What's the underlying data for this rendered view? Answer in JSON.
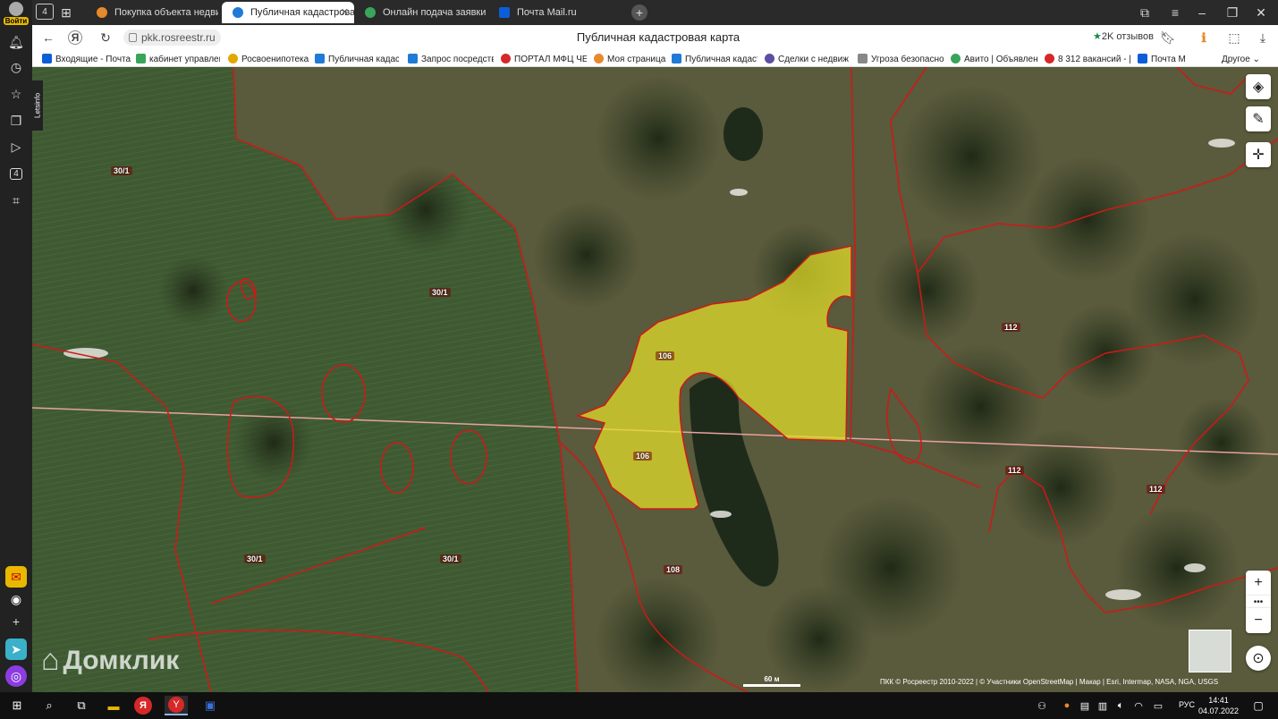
{
  "browser": {
    "login_label": "Войти",
    "tab_count": "4",
    "tabs": [
      {
        "title": "Покупка объекта недвиж",
        "icon": "yandex-realty-icon",
        "color": "#e8892b"
      },
      {
        "title": "Публичная кадастрова",
        "icon": "rosreestr-icon",
        "color": "#1e7bd6",
        "close": "✕"
      },
      {
        "title": "Онлайн подача заявки н",
        "icon": "gosuslugi-icon",
        "color": "#3aa55a"
      },
      {
        "title": "Почта Mail.ru",
        "icon": "mail-icon",
        "color": "#0b5ed7"
      }
    ],
    "url": "pkk.rosreestr.ru",
    "page_title": "Публичная кадастровая карта",
    "reviews": "2K отзывов",
    "bookmarks": [
      {
        "label": "Входящие - Почта",
        "color": "#0b5ed7"
      },
      {
        "label": "кабинет управлен",
        "color": "#3aa55a"
      },
      {
        "label": "Росвоенипотека",
        "color": "#e0a800"
      },
      {
        "label": "Публичная кадаст",
        "color": "#1e7bd6"
      },
      {
        "label": "Запрос посредств",
        "color": "#1e7bd6"
      },
      {
        "label": "ПОРТАЛ МФЦ ЧЕ",
        "color": "#d62828"
      },
      {
        "label": "Моя страница",
        "color": "#e8892b"
      },
      {
        "label": "Публичная кадаст",
        "color": "#1e7bd6"
      },
      {
        "label": "Сделки с недвиж",
        "color": "#5a4fa0"
      },
      {
        "label": "Угроза безопасно",
        "color": "#888888"
      },
      {
        "label": "Авито | Объявлен",
        "color": "#3aa55a"
      },
      {
        "label": "8 312 вакансий - |",
        "color": "#d62828"
      },
      {
        "label": "Почта М",
        "color": "#0b5ed7"
      }
    ],
    "other_bookmarks": "Другое"
  },
  "map": {
    "parcel_labels": [
      {
        "text": "30/1",
        "name": "parcel-label-30-1-a"
      },
      {
        "text": "30/1",
        "name": "parcel-label-30-1-b"
      },
      {
        "text": "30/1",
        "name": "parcel-label-30-1-c"
      },
      {
        "text": "30/1",
        "name": "parcel-label-30-1-d"
      },
      {
        "text": "106",
        "name": "parcel-label-106-a"
      },
      {
        "text": "106",
        "name": "parcel-label-106-b"
      },
      {
        "text": "108",
        "name": "parcel-label-108"
      },
      {
        "text": "112",
        "name": "parcel-label-112-a"
      },
      {
        "text": "112",
        "name": "parcel-label-112-b"
      },
      {
        "text": "112",
        "name": "parcel-label-112-c"
      }
    ],
    "scale": "60 м",
    "attribution": "ПКК © Росреестр 2010-2022 | © Участники OpenStreetMap | Макар | Esri, Intermap, NASA, NGA, USGS",
    "watermark": "Домклик",
    "side_widget": "Letsinfo",
    "selection_color": "#e6e02a",
    "boundary_color": "#d01818"
  },
  "taskbar": {
    "lang": "РУС",
    "time": "14:41",
    "date": "04.07.2022"
  }
}
